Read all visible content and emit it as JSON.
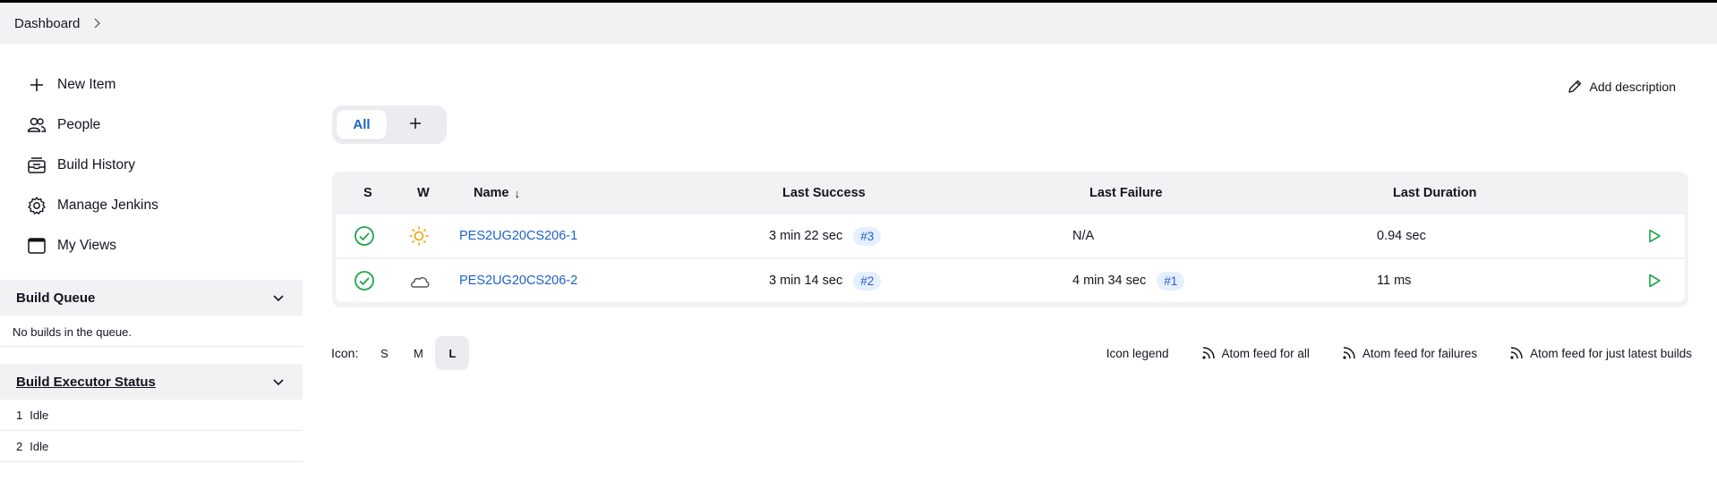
{
  "breadcrumb": {
    "items": [
      "Dashboard"
    ]
  },
  "sidebar": {
    "tasks": [
      {
        "label": "New Item",
        "icon": "plus-icon"
      },
      {
        "label": "People",
        "icon": "people-icon"
      },
      {
        "label": "Build History",
        "icon": "build-history-icon"
      },
      {
        "label": "Manage Jenkins",
        "icon": "gear-icon"
      },
      {
        "label": "My Views",
        "icon": "window-icon"
      }
    ],
    "build_queue": {
      "title": "Build Queue",
      "empty_text": "No builds in the queue."
    },
    "executors": {
      "title": "Build Executor Status",
      "rows": [
        {
          "num": "1",
          "status": "Idle"
        },
        {
          "num": "2",
          "status": "Idle"
        }
      ]
    }
  },
  "main": {
    "add_description": "Add description",
    "tabs": {
      "all_label": "All"
    },
    "table": {
      "headers": {
        "s": "S",
        "w": "W",
        "name": "Name",
        "sort_indicator": "↓",
        "last_success": "Last Success",
        "last_failure": "Last Failure",
        "last_duration": "Last Duration"
      },
      "rows": [
        {
          "status_icon": "success-check-icon",
          "weather_icon": "sunny-icon",
          "name": "PES2UG20CS206-1",
          "last_success": "3 min 22 sec",
          "last_success_build": "#3",
          "last_failure": "N/A",
          "last_failure_build": "",
          "last_duration": "0.94 sec"
        },
        {
          "status_icon": "success-check-icon",
          "weather_icon": "cloudy-icon",
          "name": "PES2UG20CS206-2",
          "last_success": "3 min 14 sec",
          "last_success_build": "#2",
          "last_failure": "4 min 34 sec",
          "last_failure_build": "#1",
          "last_duration": "11 ms"
        }
      ]
    },
    "footer": {
      "icon_label": "Icon:",
      "sizes": [
        "S",
        "M",
        "L"
      ],
      "active_size": "L",
      "legend": "Icon legend",
      "feeds": [
        "Atom feed for all",
        "Atom feed for failures",
        "Atom feed for just latest builds"
      ]
    }
  },
  "colors": {
    "link": "#1d61c9",
    "success": "#1ea64b",
    "sun": "#f0a400",
    "badge_bg": "#e6efff"
  }
}
